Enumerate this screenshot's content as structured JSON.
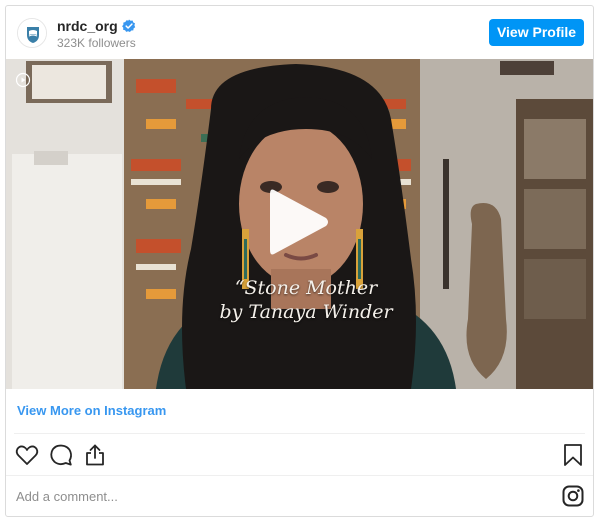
{
  "header": {
    "username": "nrdc_org",
    "followers": "323K followers",
    "view_profile_label": "View Profile",
    "verified_icon": "verified-badge-icon",
    "accent_color": "#0095f6"
  },
  "media": {
    "overlay_title_line1": "“Stone Mother",
    "overlay_title_line2": "by Tanaya Winder",
    "play_icon": "play-icon",
    "reel_icon": "reel-icon"
  },
  "links": {
    "view_more_label": "View More on Instagram"
  },
  "actions": {
    "like_icon": "heart-icon",
    "comment_icon": "comment-icon",
    "share_icon": "share-icon",
    "save_icon": "bookmark-icon"
  },
  "comment": {
    "placeholder": "Add a comment...",
    "logo_icon": "instagram-icon"
  }
}
